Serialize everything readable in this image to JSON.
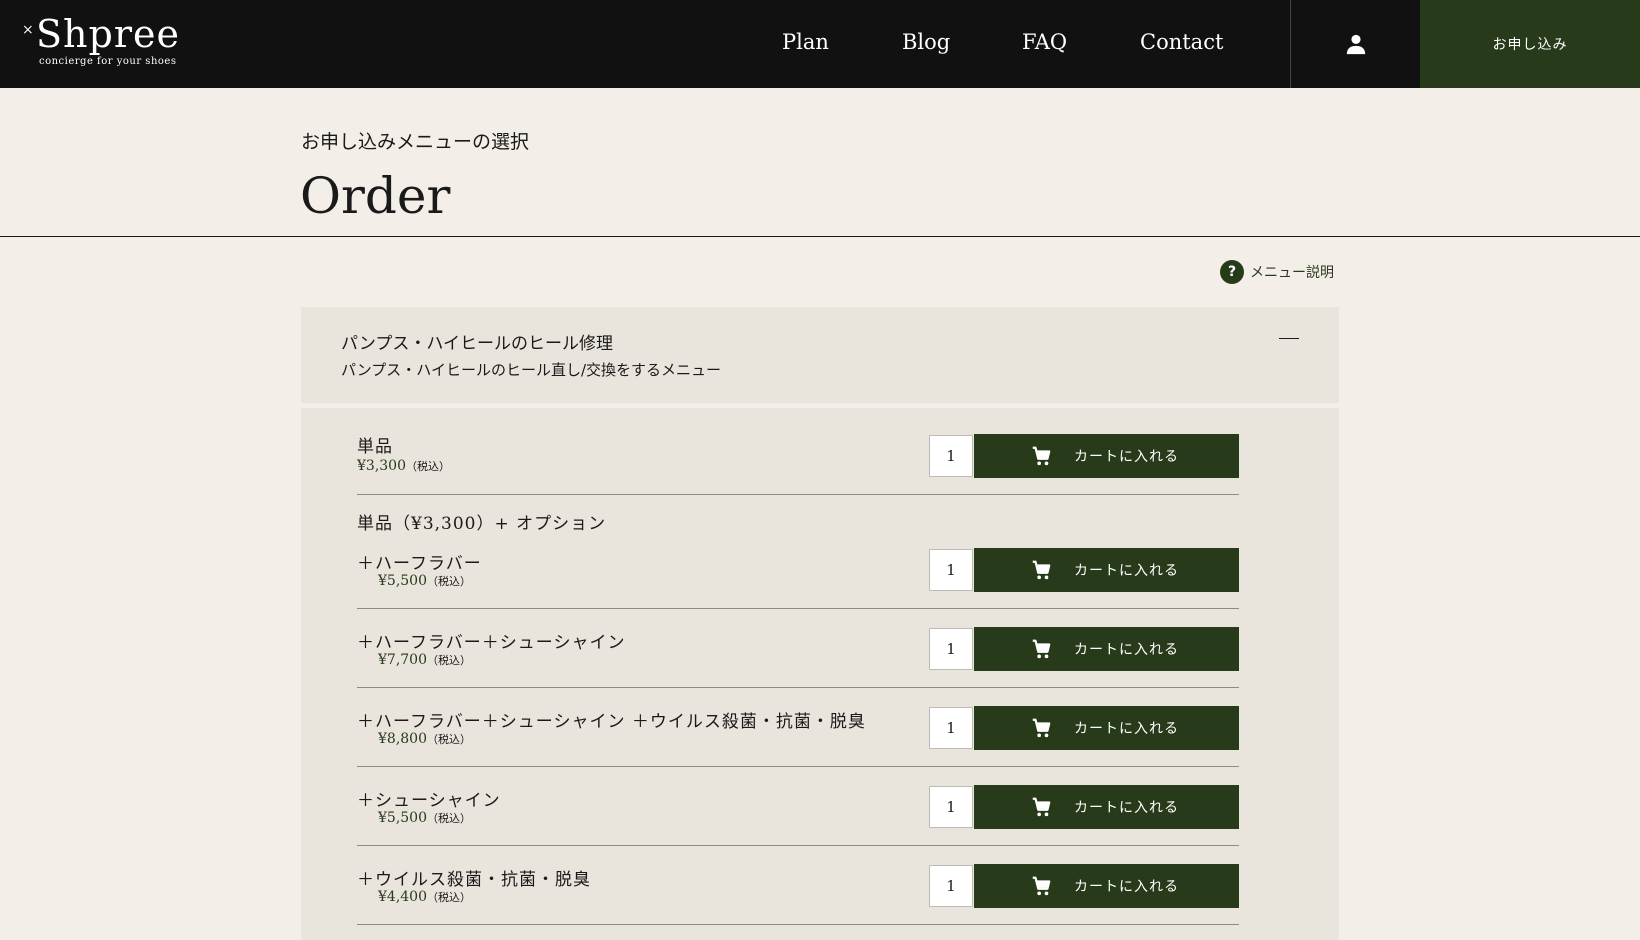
{
  "header": {
    "logo_mark": "×",
    "logo_text": "Shpree",
    "logo_tagline": "concierge for your shoes",
    "nav": [
      "Plan",
      "Blog",
      "FAQ",
      "Contact"
    ],
    "apply_label": "お申し込み"
  },
  "page": {
    "subtitle": "お申し込みメニューの選択",
    "title": "Order",
    "help_label": "メニュー説明",
    "help_glyph": "?"
  },
  "panel": {
    "title": "パンプス・ハイヒールのヒール修理",
    "description": "パンプス・ハイヒールのヒール直し/交換をするメニュー",
    "collapse_glyph": "—",
    "group_label": "単品（¥3,300）+ オプション",
    "cart_label": "カートに入れる",
    "tax_label": "（税込）",
    "items": [
      {
        "name": "単品",
        "price": "¥3,300",
        "qty": "1"
      },
      {
        "name": "＋ハーフラバー",
        "price": "¥5,500",
        "qty": "1"
      },
      {
        "name": "＋ハーフラバー＋シューシャイン",
        "price": "¥7,700",
        "qty": "1"
      },
      {
        "name": "＋ハーフラバー＋シューシャイン ＋ウイルス殺菌・抗菌・脱臭",
        "price": "¥8,800",
        "qty": "1"
      },
      {
        "name": "＋シューシャイン",
        "price": "¥5,500",
        "qty": "1"
      },
      {
        "name": "＋ウイルス殺菌・抗菌・脱臭",
        "price": "¥4,400",
        "qty": "1"
      }
    ]
  },
  "colors": {
    "accent": "#273a19",
    "header_bg": "#111111",
    "page_bg": "#f3efe8",
    "panel_bg": "#e9e5dc"
  },
  "icons": {
    "user": "user-icon",
    "cart": "cart-icon",
    "help": "question-icon",
    "collapse": "minus-icon"
  }
}
